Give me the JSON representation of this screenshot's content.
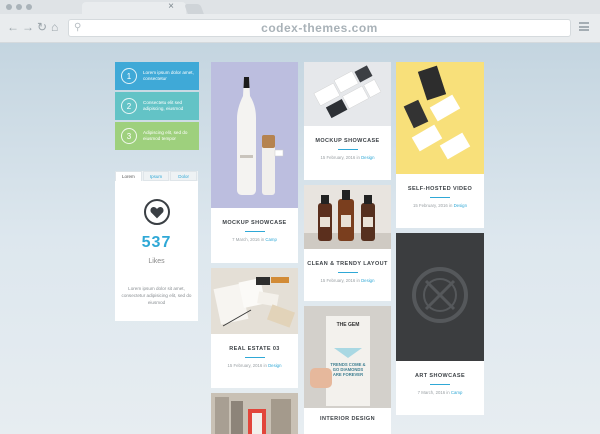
{
  "browser": {
    "url": "codex-themes.com",
    "tab_close": "×",
    "icons": {
      "back": "back-arrow-icon",
      "forward": "forward-arrow-icon",
      "reload": "reload-icon",
      "home": "home-icon",
      "search": "search-icon",
      "menu": "hamburger-menu-icon"
    }
  },
  "steps": [
    {
      "number": "1",
      "text": "Lorem ipsum dolor amet, consectetur",
      "color": "#3fa9d7"
    },
    {
      "number": "2",
      "text": "Consectetu elit sed adipiscing, eiusmod",
      "color": "#63c3c6"
    },
    {
      "number": "3",
      "text": "Adipiscing elit, sed do eiusmod tempor",
      "color": "#9ed07d"
    }
  ],
  "tabs_widget": {
    "tabs": [
      "Lorem",
      "Ipsum",
      "Dolor"
    ],
    "active_tab": "Lorem",
    "icon": "heart-icon",
    "count": "537",
    "count_label": "Likes",
    "description": "Lorem ipsum dolor sit amet, consectetur adipisicing elit, sed do eiusmod"
  },
  "cards": {
    "mockup1": {
      "title": "MOCKUP SHOWCASE",
      "date": "7 March, 2016 in",
      "category": "Camp",
      "image_bg": "#bcbedf"
    },
    "real_estate": {
      "title": "REAL ESTATE 03",
      "date": "15 February, 2016 in",
      "category": "Design",
      "image_bg": "#e4dfd6"
    },
    "mockup2": {
      "title": "MOCKUP SHOWCASE",
      "date": "15 February, 2016 in",
      "category": "Design",
      "image_bg": "#d9dde1"
    },
    "clean": {
      "title": "CLEAN & TRENDY LAYOUT",
      "date": "15 February, 2016 in",
      "category": "Design",
      "image_bg": "#e8e4df"
    },
    "interior": {
      "title": "INTERIOR DESIGN",
      "image_bg": "#d5d2cd",
      "book_brand": "THE GEM",
      "book_text": "TRENDS COME & GO DIAMONDS ARE FOREVER"
    },
    "video": {
      "title": "SELF-HOSTED VIDEO",
      "date": "15 February, 2016 in",
      "category": "Design",
      "image_bg": "#f8e07a"
    },
    "art": {
      "title": "ART SHOWCASE",
      "date": "7 March, 2016 in",
      "category": "Camp",
      "image_bg": "#3a3c3e"
    }
  },
  "colors": {
    "accent": "#2fa8d6",
    "heading": "#3d4247"
  }
}
